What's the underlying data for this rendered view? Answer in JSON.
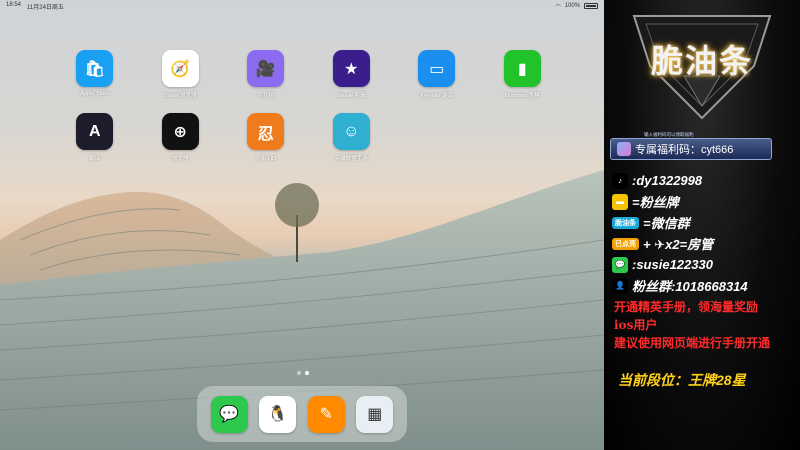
{
  "status_bar": {
    "time": "18:54",
    "date": "11月24日周五",
    "battery_pct": "100%"
  },
  "apps": [
    {
      "label": "Apple Store",
      "icon": "app-store-icon",
      "bg": "#1aa0f2",
      "glyph": "🛍"
    },
    {
      "label": "Safari 浏览器",
      "icon": "safari-icon",
      "bg": "#ffffff",
      "glyph": "🧭"
    },
    {
      "label": "可立拍",
      "icon": "clips-icon",
      "bg": "#8b6bf0",
      "glyph": "🎥"
    },
    {
      "label": "iMovie 剪辑",
      "icon": "imovie-icon",
      "bg": "#3b1e8c",
      "glyph": "★"
    },
    {
      "label": "Keynote 讲演",
      "icon": "keynote-icon",
      "bg": "#1a8ff0",
      "glyph": "▭"
    },
    {
      "label": "Numbers 表格",
      "icon": "numbers-icon",
      "bg": "#22c22a",
      "glyph": "▮"
    },
    {
      "label": "翻译",
      "icon": "translate-icon",
      "bg": "#1c1c2a",
      "glyph": "A"
    },
    {
      "label": "放大器",
      "icon": "magnifier-icon",
      "bg": "#111111",
      "glyph": "⊕"
    },
    {
      "label": "火影 HD",
      "icon": "naruto-hd-icon",
      "bg": "#f07b1c",
      "glyph": "忍"
    },
    {
      "label": "英雄联盟手游",
      "icon": "lol-mobile-icon",
      "bg": "#2fb0d0",
      "glyph": "☺"
    }
  ],
  "dock": [
    {
      "name": "wechat",
      "icon": "wechat-icon",
      "bg": "#2ec84d",
      "glyph": "💬"
    },
    {
      "name": "qq",
      "icon": "qq-icon",
      "bg": "#ffffff",
      "glyph": "🐧"
    },
    {
      "name": "pages",
      "icon": "pages-icon",
      "bg": "#ff8a00",
      "glyph": "✎"
    },
    {
      "name": "app-library",
      "icon": "app-library-icon",
      "bg": "#e9eef5",
      "glyph": "▦"
    }
  ],
  "overlay": {
    "logo": "脆油条",
    "promo_top": "输入福利码可以领取福利",
    "promo_label": "专属福利码：cyt666",
    "rows": [
      {
        "icon": "tiktok-icon",
        "bg": "#000",
        "glyph": "♪",
        "text": ":dy1322998"
      },
      {
        "icon": "fan-badge-icon",
        "bg": "#f5c400",
        "glyph": "▬",
        "text": "=粉丝牌"
      },
      {
        "icon": "oil-tag-icon",
        "bg": "#1aa8d8",
        "glyph": "脆油条",
        "text": "=微信群"
      },
      {
        "icon": "gold-tag-icon",
        "bg": "#f0a000",
        "glyph": "已点亮",
        "text": "+ ✈x2=房管"
      },
      {
        "icon": "wechat-small-icon",
        "bg": "#2ec84d",
        "glyph": "💬",
        "text": ":susie122330"
      },
      {
        "icon": "douyin-fans-icon",
        "bg": "#000",
        "glyph": "👤",
        "text": "粉丝群:1018668314"
      }
    ],
    "notice_lines": [
      "开通精英手册，领海量奖励",
      "ios用户",
      "建议使用网页端进行手册开通"
    ],
    "rank": "当前段位：王牌28星"
  }
}
